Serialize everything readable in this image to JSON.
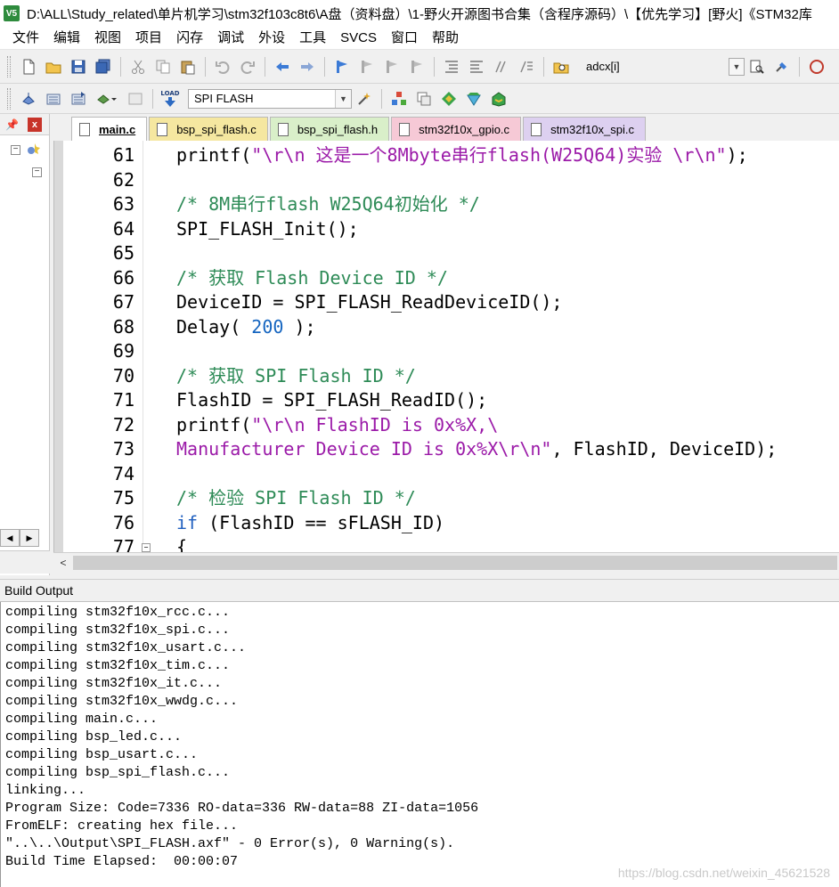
{
  "window": {
    "app_icon_label": "V5",
    "title": "D:\\ALL\\Study_related\\单片机学习\\stm32f103c8t6\\A盘（资料盘）\\1-野火开源图书合集（含程序源码）\\【优先学习】[野火]《STM32库"
  },
  "menu": [
    "文件",
    "编辑",
    "视图",
    "项目",
    "闪存",
    "调试",
    "外设",
    "工具",
    "SVCS",
    "窗口",
    "帮助"
  ],
  "toolbar1": {
    "find_combo_value": "adcx[i]"
  },
  "toolbar2": {
    "target_combo_value": "SPI FLASH",
    "load_label": "LOAD"
  },
  "project_panel": {
    "pin_icon": "pin-icon",
    "close_label": "x"
  },
  "tabs": [
    {
      "label": "main.c",
      "active": true,
      "color": "#ffffff"
    },
    {
      "label": "bsp_spi_flash.c",
      "active": false,
      "color": "#f5e7a0"
    },
    {
      "label": "bsp_spi_flash.h",
      "active": false,
      "color": "#d9efc9"
    },
    {
      "label": "stm32f10x_gpio.c",
      "active": false,
      "color": "#f6c9d6"
    },
    {
      "label": "stm32f10x_spi.c",
      "active": false,
      "color": "#ddd0f0"
    }
  ],
  "code_lines": [
    {
      "n": "61",
      "parts": [
        {
          "t": "printf(",
          "c": "plain"
        },
        {
          "t": "\"\\r\\n 这是一个8Mbyte串行flash(W25Q64)实验 \\r\\n\"",
          "c": "str"
        },
        {
          "t": ");",
          "c": "plain"
        }
      ]
    },
    {
      "n": "62",
      "parts": []
    },
    {
      "n": "63",
      "parts": [
        {
          "t": "/* 8M串行flash W25Q64初始化 */",
          "c": "comment"
        }
      ]
    },
    {
      "n": "64",
      "parts": [
        {
          "t": "SPI_FLASH_Init();",
          "c": "plain"
        }
      ]
    },
    {
      "n": "65",
      "parts": []
    },
    {
      "n": "66",
      "parts": [
        {
          "t": "/* 获取 Flash Device ID */",
          "c": "comment"
        }
      ]
    },
    {
      "n": "67",
      "parts": [
        {
          "t": "DeviceID = SPI_FLASH_ReadDeviceID();",
          "c": "plain"
        }
      ]
    },
    {
      "n": "68",
      "parts": [
        {
          "t": "Delay( ",
          "c": "plain"
        },
        {
          "t": "200",
          "c": "num"
        },
        {
          "t": " );",
          "c": "plain"
        }
      ]
    },
    {
      "n": "69",
      "parts": []
    },
    {
      "n": "70",
      "parts": [
        {
          "t": "/* 获取 SPI Flash ID */",
          "c": "comment"
        }
      ]
    },
    {
      "n": "71",
      "parts": [
        {
          "t": "FlashID = SPI_FLASH_ReadID();",
          "c": "plain"
        }
      ]
    },
    {
      "n": "72",
      "parts": [
        {
          "t": "printf(",
          "c": "plain"
        },
        {
          "t": "\"\\r\\n FlashID is 0x%X,\\",
          "c": "str"
        }
      ]
    },
    {
      "n": "73",
      "parts": [
        {
          "t": "Manufacturer Device ID is 0x%X\\r\\n\"",
          "c": "str"
        },
        {
          "t": ", FlashID, DeviceID);",
          "c": "plain"
        }
      ]
    },
    {
      "n": "74",
      "parts": []
    },
    {
      "n": "75",
      "parts": [
        {
          "t": "/* 检验 SPI Flash ID */",
          "c": "comment"
        }
      ]
    },
    {
      "n": "76",
      "parts": [
        {
          "t": "if",
          "c": "kw"
        },
        {
          "t": " (FlashID == sFLASH_ID)",
          "c": "plain"
        }
      ]
    },
    {
      "n": "77",
      "parts": [
        {
          "t": "{",
          "c": "plain"
        }
      ]
    }
  ],
  "build_output": {
    "title": "Build Output",
    "lines": [
      "compiling stm32f10x_rcc.c...",
      "compiling stm32f10x_spi.c...",
      "compiling stm32f10x_usart.c...",
      "compiling stm32f10x_tim.c...",
      "compiling stm32f10x_it.c...",
      "compiling stm32f10x_wwdg.c...",
      "compiling main.c...",
      "compiling bsp_led.c...",
      "compiling bsp_usart.c...",
      "compiling bsp_spi_flash.c...",
      "linking...",
      "Program Size: Code=7336 RO-data=336 RW-data=88 ZI-data=1056",
      "FromELF: creating hex file...",
      "\"..\\..\\Output\\SPI_FLASH.axf\" - 0 Error(s), 0 Warning(s).",
      "Build Time Elapsed:  00:00:07"
    ],
    "watermark": "https://blog.csdn.net/weixin_45621528"
  }
}
